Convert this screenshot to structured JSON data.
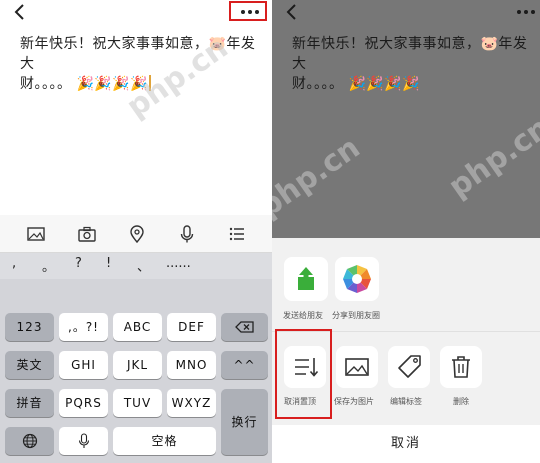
{
  "note": {
    "line1": "新年快乐！祝大家事事如意，🐷年发大",
    "line2": "财。。。。"
  },
  "keyboard": {
    "toolbar_icons": [
      "image-icon",
      "camera-icon",
      "location-icon",
      "microphone-icon",
      "list-icon"
    ],
    "punctuation": [
      ",",
      "。",
      "?",
      "!",
      "、",
      "......"
    ],
    "rows": {
      "r1": [
        "123",
        ",。?!",
        "ABC",
        "DEF"
      ],
      "r2": [
        "英文",
        "GHI",
        "JKL",
        "MNO",
        "^^"
      ],
      "r3": [
        "拼音",
        "PQRS",
        "TUV",
        "WXYZ"
      ],
      "r4": [
        "空格"
      ]
    },
    "enter_label": "换行"
  },
  "sheet": {
    "share": [
      {
        "label": "发送给朋友",
        "icon": "share-upload-icon"
      },
      {
        "label": "分享到朋友圈",
        "icon": "moments-icon"
      }
    ],
    "actions": [
      {
        "label": "取消置顶",
        "icon": "unpin-icon"
      },
      {
        "label": "保存为图片",
        "icon": "picture-icon"
      },
      {
        "label": "编辑标签",
        "icon": "tag-icon"
      },
      {
        "label": "删除",
        "icon": "trash-icon"
      }
    ],
    "cancel": "取消"
  },
  "watermark": "php.cn",
  "colors": {
    "highlight": "#d81e1e",
    "share_green": "#3aae3a"
  }
}
